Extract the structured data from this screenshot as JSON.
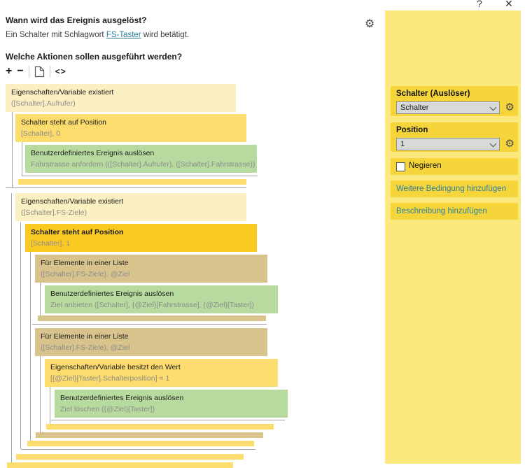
{
  "window": {
    "help_label": "?",
    "close_label": "✕"
  },
  "icons": {
    "gear": "⚙",
    "copy": "copy-document",
    "code": "<>"
  },
  "trigger": {
    "question": "Wann wird das Ereignis ausgelöst?",
    "sentence_prefix": "Ein Schalter mit Schlagwort ",
    "keyword_link": "FS-Taster",
    "sentence_suffix": " wird betätigt."
  },
  "actions": {
    "question": "Welche Aktionen sollen ausgeführt werden?",
    "toolbar": {
      "add": "+",
      "remove": "−",
      "code": "<>"
    }
  },
  "tree": {
    "blocks": [
      {
        "type": "pale",
        "title": "Eigenschaften/Variable existiert",
        "subtitle": "([Schalter].Aufrufer)"
      },
      {
        "type": "yellow",
        "title": "Schalter steht auf Position",
        "subtitle": "[Schalter], 0"
      },
      {
        "type": "green",
        "title": "Benutzerdefiniertes Ereignis auslösen",
        "subtitle": "Fahrstrasse anfordern (([Schalter].Aufrufer), ([Schalter].Fahrstrasse))"
      },
      {
        "type": "pale",
        "title": "Eigenschaften/Variable existiert",
        "subtitle": "([Schalter].FS-Ziele)"
      },
      {
        "type": "gold",
        "title": "Schalter steht auf Position",
        "subtitle": "[Schalter], 1",
        "selected": true
      },
      {
        "type": "tan",
        "title": "Für Elemente in einer Liste",
        "subtitle": "([Schalter].FS-Ziele), @Ziel"
      },
      {
        "type": "green",
        "title": "Benutzerdefiniertes Ereignis auslösen",
        "subtitle": "Ziel anbieten ([Schalter], {@Ziel}[Fahrstrasse], {@Ziel}[Taster])"
      },
      {
        "type": "tan",
        "title": "Für Elemente in einer Liste",
        "subtitle": "([Schalter].FS-Ziele), @Ziel"
      },
      {
        "type": "yellow",
        "title": "Eigenschaften/Variable besitzt den Wert",
        "subtitle": "[{@Ziel}[Taster].Schalterposition] = 1"
      },
      {
        "type": "green",
        "title": "Benutzerdefiniertes Ereignis auslösen",
        "subtitle": "Ziel löschen ({@Ziel}[Taster])"
      }
    ]
  },
  "panel": {
    "fields": [
      {
        "label": "Schalter (Auslöser)",
        "value": "Schalter"
      },
      {
        "label": "Position",
        "value": "1"
      }
    ],
    "negate": {
      "label": "Negieren",
      "checked": false
    },
    "links": [
      {
        "label": "Weitere Bedingung hinzufügen"
      },
      {
        "label": "Beschreibung hinzufügen"
      }
    ]
  },
  "colors": {
    "panel_bg": "#fbe97e",
    "panel_box": "#f6d53b",
    "block_pale": "#fbf0c2",
    "block_yellow": "#fcdc6d",
    "block_selected": "#fbca22",
    "block_tan": "#d8c38d",
    "block_green": "#b7db9f",
    "link_teal": "#2e7f9c",
    "subtitle_grey": "#8c8c8c",
    "line_grey": "#a3a3a3"
  }
}
